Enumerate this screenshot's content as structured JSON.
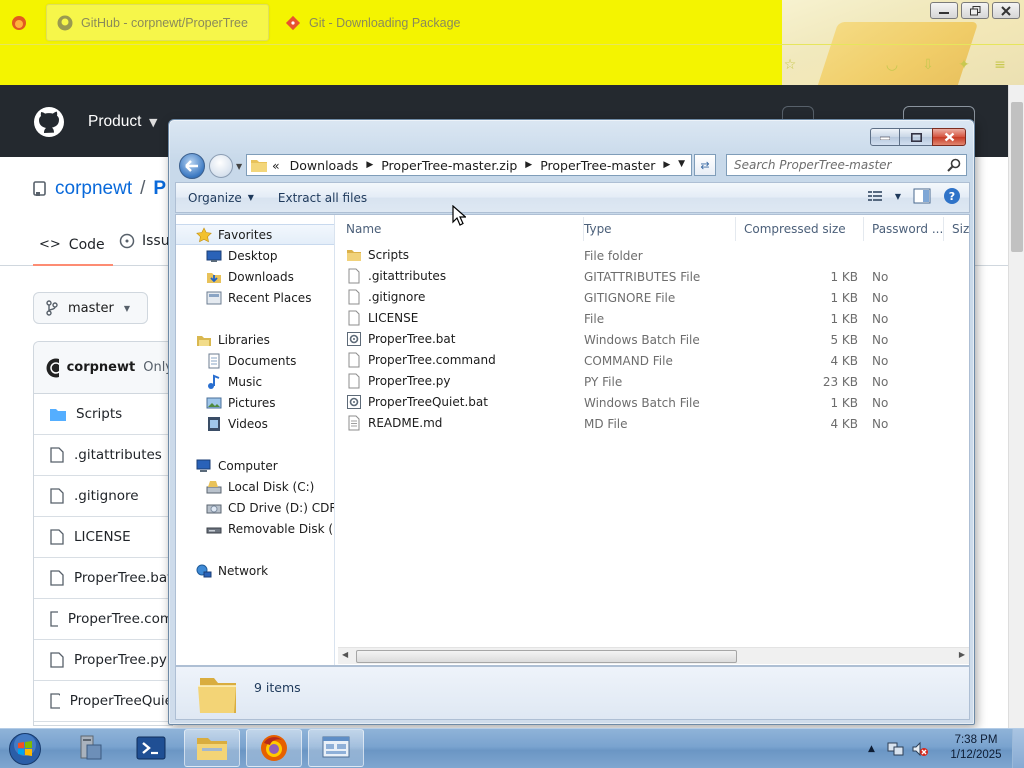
{
  "browser": {
    "tabs": [
      {
        "label": "GitHub - corpnewt/ProperTree",
        "active": true
      },
      {
        "label": "Git - Downloading Package",
        "active": false
      }
    ],
    "theme_color": "#f4f400"
  },
  "github": {
    "nav_product": "Product",
    "owner": "corpnewt",
    "separator": "/",
    "repo_initial": "P",
    "tab_code": "Code",
    "tab_issues": "Issu",
    "branch": "master",
    "commit_author": "corpnewt",
    "commit_note": "Only",
    "files": [
      "Scripts",
      ".gitattributes",
      ".gitignore",
      "LICENSE",
      "ProperTree.bat",
      "ProperTree.com",
      "ProperTree.py",
      "ProperTreeQuie"
    ]
  },
  "explorer": {
    "address": [
      "Downloads",
      "ProperTree-master.zip",
      "ProperTree-master"
    ],
    "address_prefix": "«",
    "search_placeholder": "Search ProperTree-master",
    "toolbar": {
      "organize": "Organize",
      "extract": "Extract all files"
    },
    "nav": {
      "favorites": "Favorites",
      "desktop": "Desktop",
      "downloads": "Downloads",
      "recent": "Recent Places",
      "libraries": "Libraries",
      "documents": "Documents",
      "music": "Music",
      "pictures": "Pictures",
      "videos": "Videos",
      "computer": "Computer",
      "local_disk": "Local Disk (C:)",
      "cd_drive": "CD Drive (D:) CDROM",
      "removable": "Removable Disk (E:)",
      "network": "Network"
    },
    "columns": {
      "name": "Name",
      "type": "Type",
      "size": "Compressed size",
      "password": "Password ...",
      "size2": "Size"
    },
    "files": [
      {
        "name": "Scripts",
        "type": "File folder",
        "size": "",
        "password": "",
        "icon": "folder-icon"
      },
      {
        "name": ".gitattributes",
        "type": "GITATTRIBUTES File",
        "size": "1 KB",
        "password": "No",
        "icon": "file-icon"
      },
      {
        "name": ".gitignore",
        "type": "GITIGNORE File",
        "size": "1 KB",
        "password": "No",
        "icon": "file-icon"
      },
      {
        "name": "LICENSE",
        "type": "File",
        "size": "1 KB",
        "password": "No",
        "icon": "file-icon"
      },
      {
        "name": "ProperTree.bat",
        "type": "Windows Batch File",
        "size": "5 KB",
        "password": "No",
        "icon": "batch-file-icon"
      },
      {
        "name": "ProperTree.command",
        "type": "COMMAND File",
        "size": "4 KB",
        "password": "No",
        "icon": "file-icon"
      },
      {
        "name": "ProperTree.py",
        "type": "PY File",
        "size": "23 KB",
        "password": "No",
        "icon": "file-icon"
      },
      {
        "name": "ProperTreeQuiet.bat",
        "type": "Windows Batch File",
        "size": "1 KB",
        "password": "No",
        "icon": "batch-file-icon"
      },
      {
        "name": "README.md",
        "type": "MD File",
        "size": "4 KB",
        "password": "No",
        "icon": "text-file-icon"
      }
    ],
    "status": "9 items"
  },
  "taskbar": {
    "time": "7:38 PM",
    "date": "1/12/2025"
  }
}
